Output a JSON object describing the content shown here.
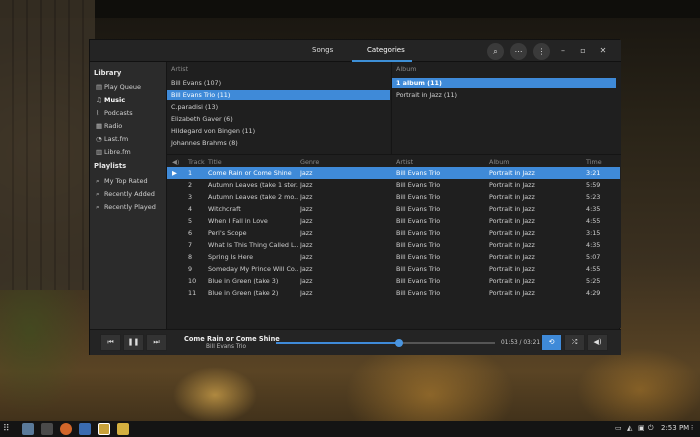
{
  "header": {
    "tabs": [
      "Songs",
      "Categories"
    ],
    "active_tab": 1
  },
  "sidebar": {
    "library_heading": "Library",
    "library_items": [
      {
        "label": "Play Queue",
        "icon": "file-icon"
      },
      {
        "label": "Music",
        "icon": "music-note-icon",
        "bold": true
      },
      {
        "label": "Podcasts",
        "icon": "rss-icon"
      },
      {
        "label": "Radio",
        "icon": "radio-icon"
      },
      {
        "label": "Last.fm",
        "icon": "lastfm-icon"
      },
      {
        "label": "Libre.fm",
        "icon": "librefm-icon"
      }
    ],
    "playlists_heading": "Playlists",
    "playlist_items": [
      {
        "label": "My Top Rated",
        "icon": "search-icon"
      },
      {
        "label": "Recently Added",
        "icon": "search-icon"
      },
      {
        "label": "Recently Played",
        "icon": "search-icon"
      }
    ]
  },
  "artist_pane": {
    "header": "Artist",
    "rows": [
      "Bill Evans (107)",
      "Bill Evans Trio (11)",
      "C.paradisi (13)",
      "Elizabeth Gaver (6)",
      "Hildegard von Bingen (11)",
      "Johannes Brahms (8)"
    ],
    "selected": 1
  },
  "album_pane": {
    "header": "Album",
    "rows": [
      "1 album (11)",
      "Portrait in Jazz (11)"
    ],
    "selected": 0
  },
  "tracks": {
    "columns": [
      "Track",
      "Title",
      "Genre",
      "Artist",
      "Album",
      "Time"
    ],
    "rows": [
      {
        "track": "1",
        "title": "Come Rain or Come Shine",
        "genre": "Jazz",
        "artist": "Bill Evans Trio",
        "album": "Portrait in Jazz",
        "time": "3:21"
      },
      {
        "track": "2",
        "title": "Autumn Leaves (take 1 ster...",
        "genre": "Jazz",
        "artist": "Bill Evans Trio",
        "album": "Portrait in Jazz",
        "time": "5:59"
      },
      {
        "track": "3",
        "title": "Autumn Leaves (take 2 mo...",
        "genre": "Jazz",
        "artist": "Bill Evans Trio",
        "album": "Portrait in Jazz",
        "time": "5:23"
      },
      {
        "track": "4",
        "title": "Witchcraft",
        "genre": "Jazz",
        "artist": "Bill Evans Trio",
        "album": "Portrait in Jazz",
        "time": "4:35"
      },
      {
        "track": "5",
        "title": "When I Fall in Love",
        "genre": "Jazz",
        "artist": "Bill Evans Trio",
        "album": "Portrait in Jazz",
        "time": "4:55"
      },
      {
        "track": "6",
        "title": "Peri's Scope",
        "genre": "Jazz",
        "artist": "Bill Evans Trio",
        "album": "Portrait in Jazz",
        "time": "3:15"
      },
      {
        "track": "7",
        "title": "What Is This Thing Called L...",
        "genre": "Jazz",
        "artist": "Bill Evans Trio",
        "album": "Portrait in Jazz",
        "time": "4:35"
      },
      {
        "track": "8",
        "title": "Spring Is Here",
        "genre": "Jazz",
        "artist": "Bill Evans Trio",
        "album": "Portrait in Jazz",
        "time": "5:07"
      },
      {
        "track": "9",
        "title": "Someday My Prince Will Co...",
        "genre": "Jazz",
        "artist": "Bill Evans Trio",
        "album": "Portrait in Jazz",
        "time": "4:55"
      },
      {
        "track": "10",
        "title": "Blue in Green (take 3)",
        "genre": "Jazz",
        "artist": "Bill Evans Trio",
        "album": "Portrait in Jazz",
        "time": "5:25"
      },
      {
        "track": "11",
        "title": "Blue in Green (take 2)",
        "genre": "Jazz",
        "artist": "Bill Evans Trio",
        "album": "Portrait in Jazz",
        "time": "4:29"
      }
    ],
    "playing_index": 0
  },
  "player": {
    "title": "Come Rain or Come Shine",
    "artist": "Bill Evans Trio",
    "time": "01:53 / 03:21",
    "progress": 0.56
  },
  "taskbar": {
    "clock": "2:53 PM"
  },
  "colors": {
    "accent": "#3f8ad8"
  }
}
